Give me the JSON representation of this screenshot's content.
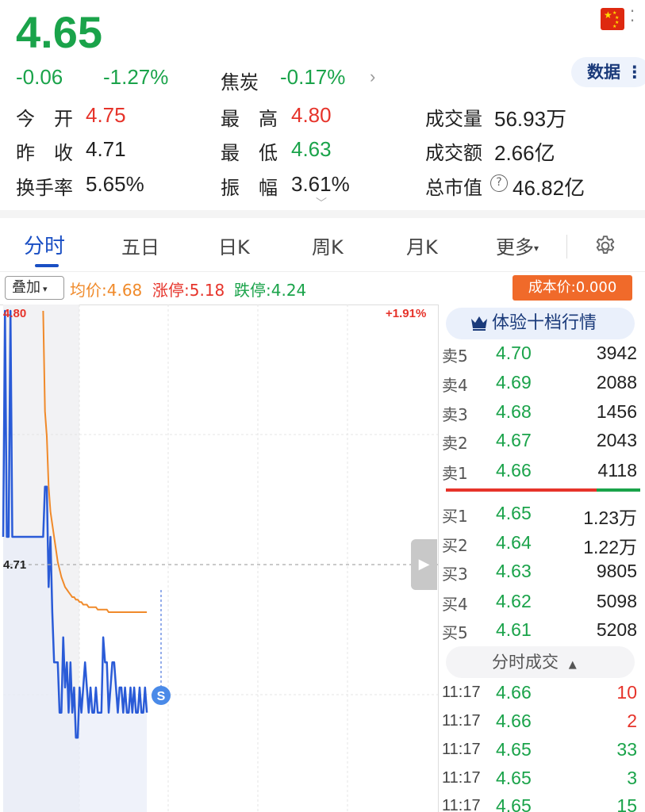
{
  "quote": {
    "price": "4.65",
    "change": "-0.06",
    "change_pct": "-1.27%",
    "sector_name": "焦炭",
    "sector_change": "-0.17%",
    "data_button": "数据"
  },
  "stats": {
    "open_label": "今　开",
    "open": "4.75",
    "prev_close_label": "昨　收",
    "prev_close": "4.71",
    "turnover_label": "换手率",
    "turnover": "5.65%",
    "high_label": "最　高",
    "high": "4.80",
    "low_label": "最　低",
    "low": "4.63",
    "amplitude_label": "振　幅",
    "amplitude": "3.61%",
    "volume_label": "成交量",
    "volume": "56.93万",
    "amount_label": "成交额",
    "amount": "2.66亿",
    "market_cap_label": "总市值",
    "market_cap": "46.82亿"
  },
  "tabs": [
    {
      "label": "分时",
      "active": true
    },
    {
      "label": "五日"
    },
    {
      "label": "日K"
    },
    {
      "label": "周K"
    },
    {
      "label": "月K"
    },
    {
      "label": "更多"
    }
  ],
  "overlay": {
    "button": "叠加",
    "avg": "均价:4.68",
    "limit_up": "涨停:5.18",
    "limit_down": "跌停:4.24",
    "cost": "成本价:0.000"
  },
  "chart_labels": {
    "top_price": "4.80",
    "mid_price": "4.71",
    "top_pct": "+1.91%"
  },
  "chart_data": {
    "type": "line",
    "ylim": [
      4.62,
      4.8
    ],
    "x_count": 240,
    "series": [
      {
        "values": [
          4.71,
          4.8,
          4.71,
          4.71,
          4.8,
          4.71,
          4.71,
          4.71,
          4.71,
          4.71,
          4.71,
          4.71,
          4.71,
          4.71,
          4.71,
          4.71,
          4.71,
          4.71,
          4.71,
          4.71,
          4.71,
          4.71,
          4.71,
          4.73,
          4.73,
          4.69,
          4.71,
          4.68,
          4.66,
          4.66,
          4.66,
          4.64,
          4.64,
          4.67,
          4.65,
          4.66,
          4.64,
          4.66,
          4.64,
          4.65,
          4.63,
          4.63,
          4.65,
          4.64,
          4.65,
          4.66,
          4.65,
          4.64,
          4.65,
          4.64,
          4.64,
          4.65,
          4.64,
          4.64,
          4.64,
          4.67,
          4.66,
          4.66,
          4.64,
          4.65,
          4.66,
          4.66,
          4.65,
          4.64,
          4.65,
          4.65,
          4.64,
          4.65,
          4.64,
          4.64,
          4.65,
          4.64,
          4.65,
          4.64,
          4.64,
          4.65,
          4.64,
          4.64,
          4.65,
          4.64
        ]
      },
      {
        "values": [
          4.8,
          4.8,
          4.8,
          4.8,
          4.8,
          4.8,
          4.8,
          4.8,
          4.8,
          4.8,
          4.8,
          4.8,
          4.8,
          4.8,
          4.8,
          4.8,
          4.8,
          4.8,
          4.8,
          4.8,
          4.8,
          4.8,
          4.8,
          4.76,
          4.75,
          4.73,
          4.72,
          4.715,
          4.71,
          4.705,
          4.7,
          4.697,
          4.694,
          4.692,
          4.69,
          4.689,
          4.688,
          4.687,
          4.686,
          4.686,
          4.685,
          4.685,
          4.684,
          4.684,
          4.683,
          4.683,
          4.683,
          4.682,
          4.682,
          4.682,
          4.682,
          4.682,
          4.681,
          4.681,
          4.681,
          4.681,
          4.681,
          4.681,
          4.68,
          4.68,
          4.68,
          4.68,
          4.68,
          4.68,
          4.68,
          4.68,
          4.68,
          4.68,
          4.68,
          4.68,
          4.68,
          4.68,
          4.68,
          4.68,
          4.68,
          4.68,
          4.68,
          4.68,
          4.68,
          4.68
        ]
      }
    ]
  },
  "order_book": {
    "button": "体验十档行情",
    "asks": [
      {
        "label": "卖5",
        "price": "4.70",
        "vol": "3942"
      },
      {
        "label": "卖4",
        "price": "4.69",
        "vol": "2088"
      },
      {
        "label": "卖3",
        "price": "4.68",
        "vol": "1456"
      },
      {
        "label": "卖2",
        "price": "4.67",
        "vol": "2043"
      },
      {
        "label": "卖1",
        "price": "4.66",
        "vol": "4118"
      }
    ],
    "bids": [
      {
        "label": "买1",
        "price": "4.65",
        "vol": "1.23万"
      },
      {
        "label": "买2",
        "price": "4.64",
        "vol": "1.22万"
      },
      {
        "label": "买3",
        "price": "4.63",
        "vol": "9805"
      },
      {
        "label": "买4",
        "price": "4.62",
        "vol": "5098"
      },
      {
        "label": "买5",
        "price": "4.61",
        "vol": "5208"
      }
    ]
  },
  "trades": {
    "button": "分时成交",
    "rows": [
      {
        "time": "11:17",
        "price": "4.66",
        "vol": "10",
        "color": "#e6332a"
      },
      {
        "time": "11:17",
        "price": "4.66",
        "vol": "2",
        "color": "#e6332a"
      },
      {
        "time": "11:17",
        "price": "4.65",
        "vol": "33",
        "color": "#1aa34a"
      },
      {
        "time": "11:17",
        "price": "4.65",
        "vol": "3",
        "color": "#1aa34a"
      },
      {
        "time": "11:17",
        "price": "4.65",
        "vol": "15",
        "color": "#1aa34a"
      }
    ]
  },
  "colors": {
    "up": "#e6332a",
    "down": "#1aa34a",
    "price_line": "#2a5bd7",
    "avg_line": "#f08a2a"
  }
}
